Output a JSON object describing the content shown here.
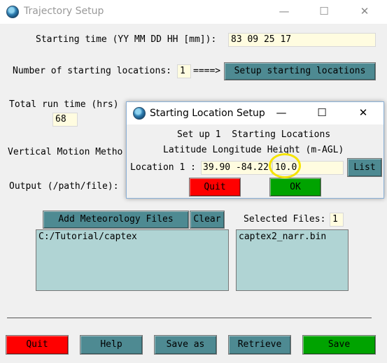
{
  "main": {
    "title": "Trajectory Setup",
    "caption": {
      "minimize": "—",
      "maximize": "☐",
      "close": "✕"
    },
    "starting_time": {
      "label": "Starting time (YY MM DD HH [mm]):",
      "value": "83 09 25 17"
    },
    "num_locations": {
      "label": "Number of starting locations:",
      "value": "1",
      "arrow": "====>",
      "setup_button": "Setup starting locations"
    },
    "run_time": {
      "label": "Total run time (hrs)",
      "value": "68"
    },
    "vertical_motion": {
      "label": "Vertical Motion Metho"
    },
    "output": {
      "label": "Output (/path/file):"
    },
    "meteorology": {
      "add_button": "Add Meteorology Files",
      "clear_button": "Clear",
      "selected_label": "Selected Files:",
      "selected_count": "1",
      "directory_list": [
        "C:/Tutorial/captex"
      ],
      "file_list": [
        "captex2_narr.bin"
      ]
    },
    "buttons": {
      "quit": "Quit",
      "help": "Help",
      "save_as": "Save as",
      "retrieve": "Retrieve",
      "save": "Save"
    }
  },
  "dialog": {
    "title": "Starting Location Setup",
    "caption": {
      "minimize": "—",
      "maximize": "☐",
      "close": "✕"
    },
    "setup_text_prefix": "Set up 1",
    "setup_text_suffix": "Starting Locations",
    "columns_header": "Latitude Longitude Height (m-AGL)",
    "location_label": "Location 1 :",
    "location_value": "39.90 -84.22",
    "height_value": "10.0",
    "list_button": "List",
    "quit_button": "Quit",
    "ok_button": "OK"
  },
  "colors": {
    "teal_button": "#4e8a92",
    "quit_red": "#ff0000",
    "ok_green": "#00a300",
    "input_yellow": "#fffce0",
    "list_teal": "#b0d4d4",
    "highlight_ring": "#f5e400"
  }
}
